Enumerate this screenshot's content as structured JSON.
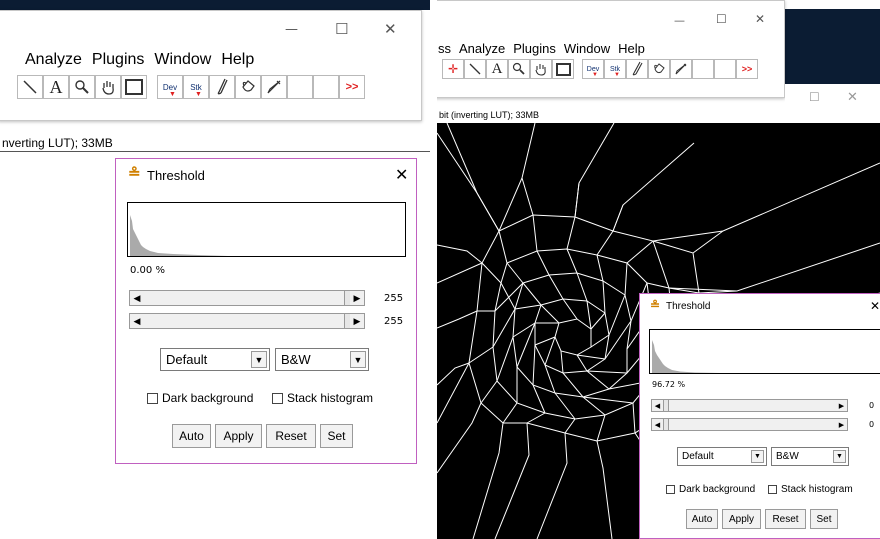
{
  "left": {
    "window_controls": {
      "minimize": "—",
      "maximize": "☐",
      "close": "✕"
    },
    "menu": [
      "Analyze",
      "Plugins",
      "Window",
      "Help"
    ],
    "toolbar": {
      "text_tool": "A",
      "dev_label": "Dev",
      "stk_label": "Stk",
      "more": ">>"
    },
    "status": "nverting LUT); 33MB",
    "threshold": {
      "title": "Threshold",
      "close": "✕",
      "percent": "0.00 %",
      "slider1_value": "255",
      "slider2_value": "255",
      "method": "Default",
      "mode": "B&W",
      "dark_background": "Dark background",
      "stack_histogram": "Stack histogram",
      "buttons": {
        "auto": "Auto",
        "apply": "Apply",
        "reset": "Reset",
        "set": "Set"
      }
    }
  },
  "right": {
    "window_controls": {
      "minimize": "—",
      "maximize": "☐",
      "close": "✕"
    },
    "menu": [
      "ss",
      "Analyze",
      "Plugins",
      "Window",
      "Help"
    ],
    "toolbar": {
      "text_tool": "A",
      "dev_label": "Dev",
      "stk_label": "Stk",
      "more": ">>"
    },
    "image_window_controls": {
      "maximize": "☐",
      "close": "✕"
    },
    "status": "bit (inverting LUT); 33MB",
    "threshold": {
      "title": "Threshold",
      "close": "✕",
      "percent": "96.72 %",
      "slider1_value": "0",
      "slider2_value": "0",
      "method": "Default",
      "mode": "B&W",
      "dark_background": "Dark background",
      "stack_histogram": "Stack histogram",
      "buttons": {
        "auto": "Auto",
        "apply": "Apply",
        "reset": "Reset",
        "set": "Set"
      }
    }
  },
  "colors": {
    "dialog_border": "#c060c0",
    "taskbar": "#0b1c33",
    "more_arrows": "#e02020"
  }
}
